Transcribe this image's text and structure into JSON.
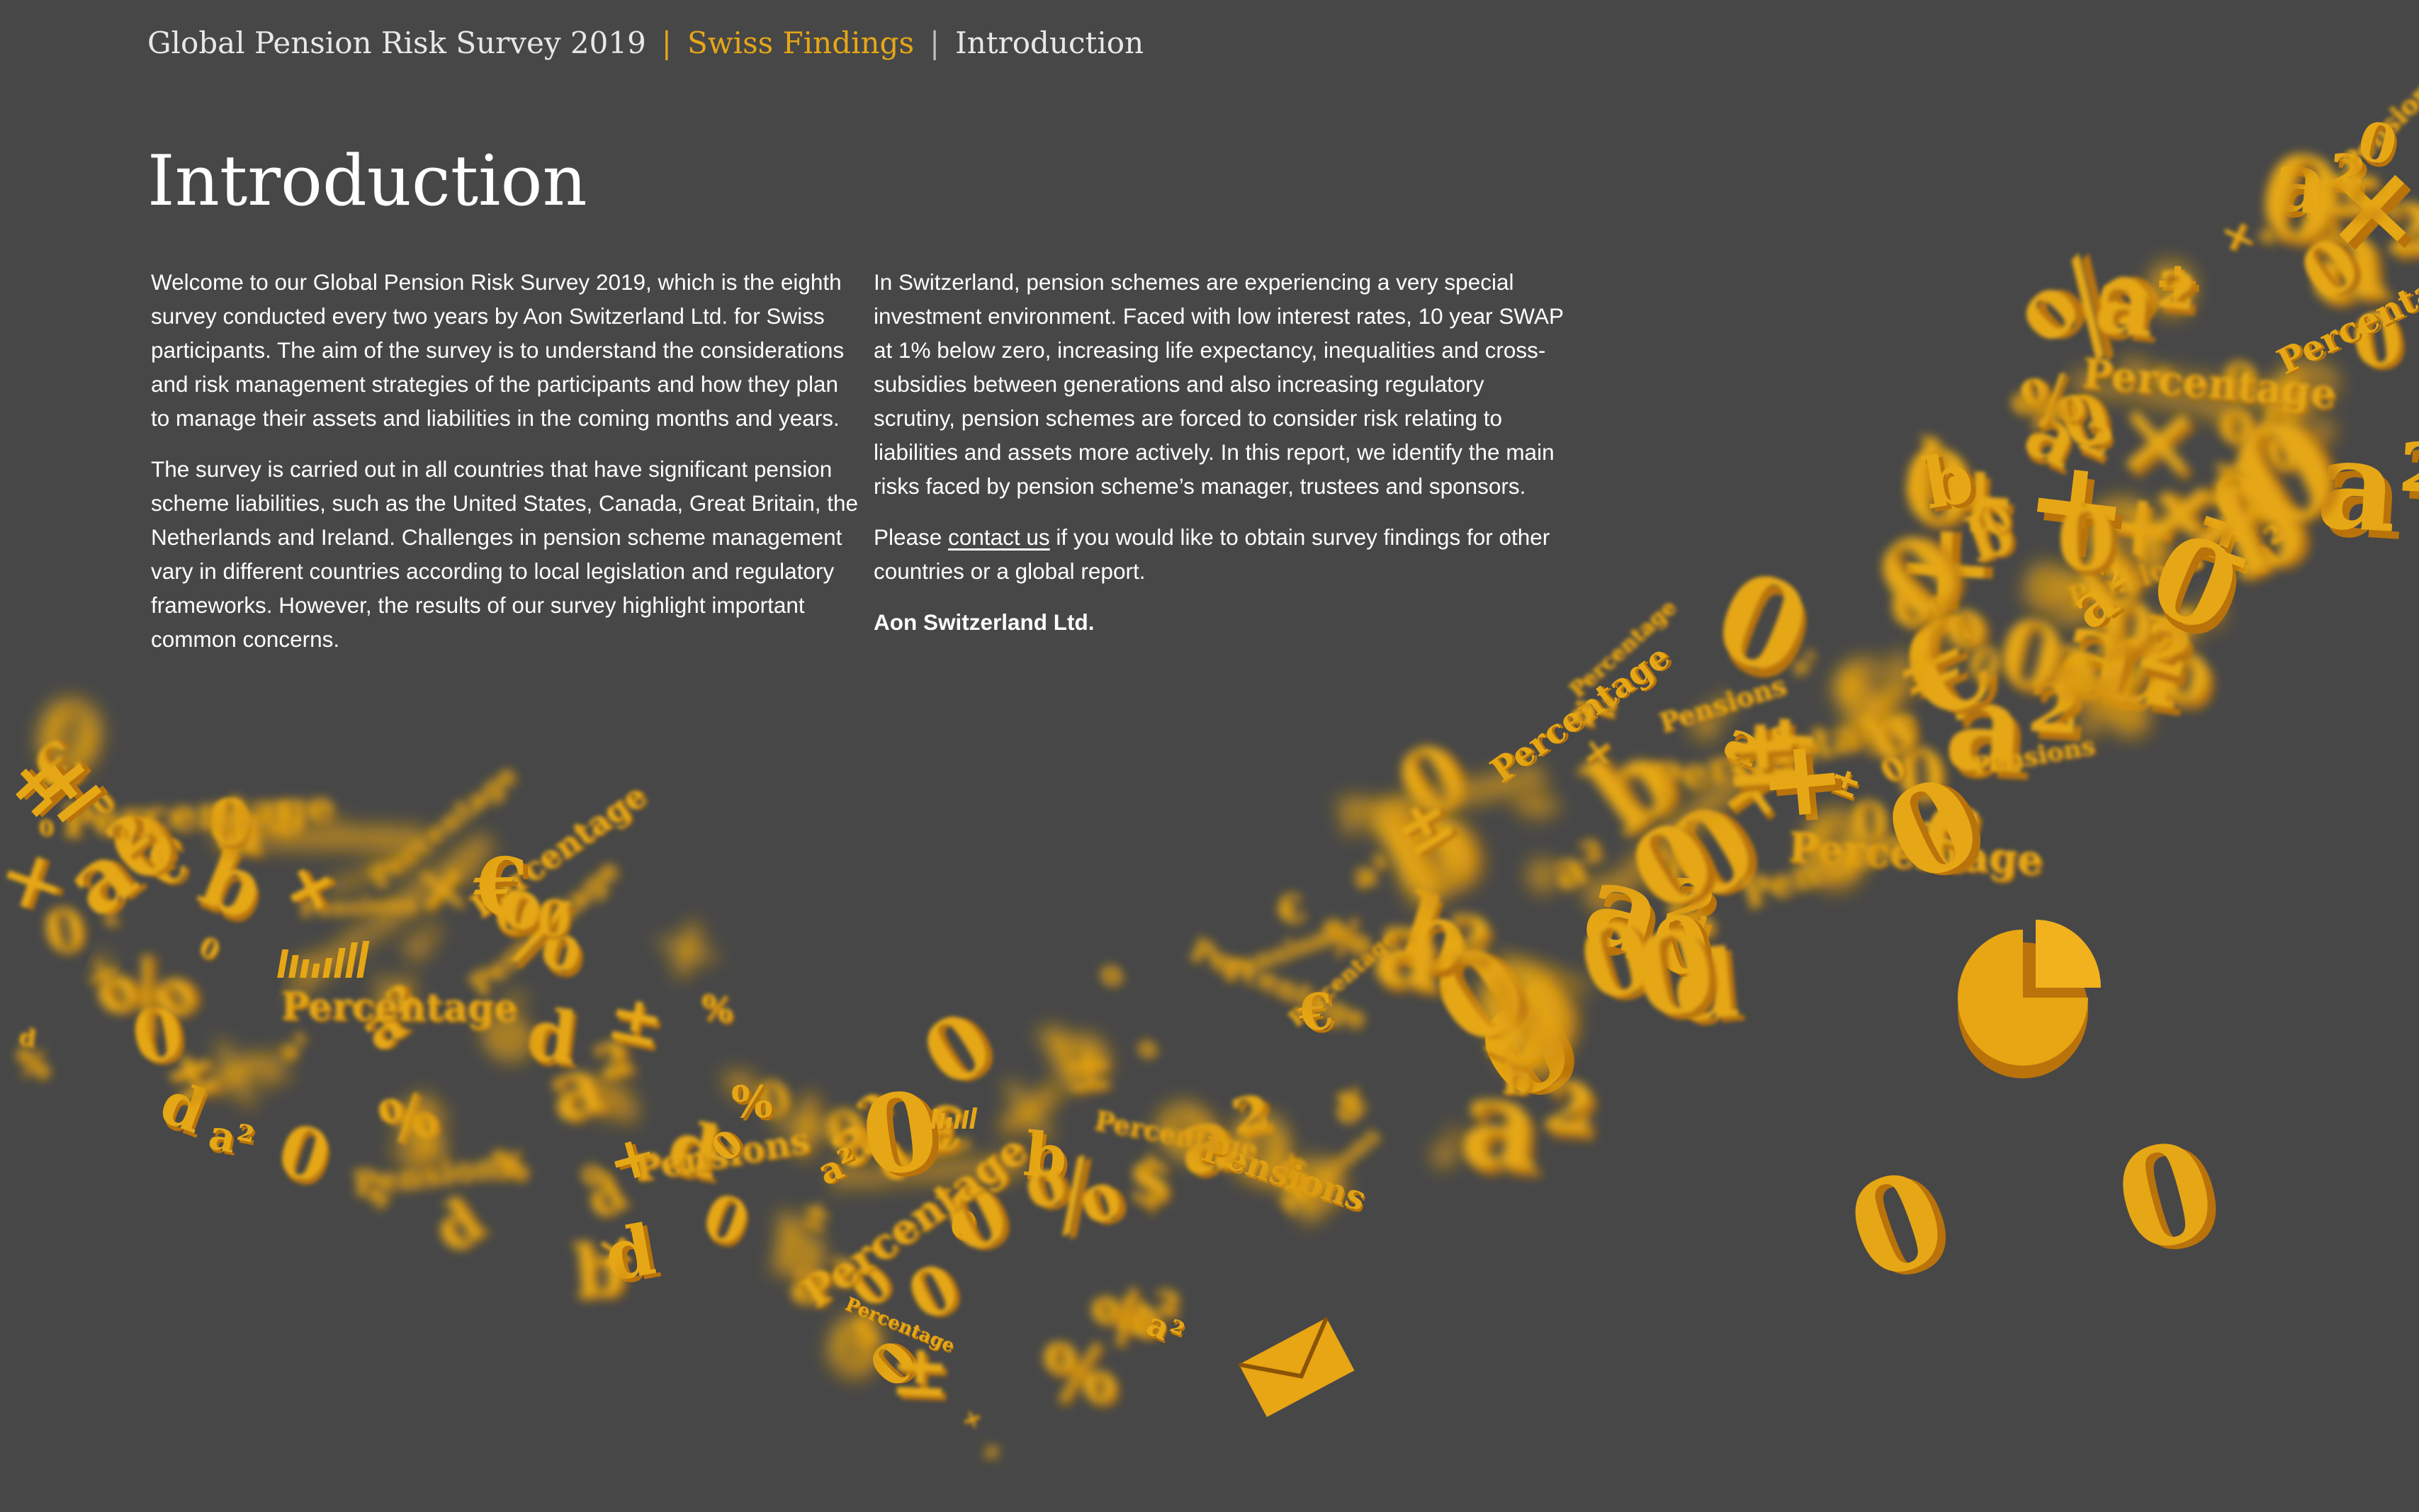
{
  "header": {
    "report_title": "Global Pension Risk Survey 2019",
    "section": "Swiss Findings",
    "current_page": "Introduction",
    "separator": "|"
  },
  "main": {
    "title": "Introduction",
    "left_column": {
      "paragraph_1": "Welcome to our Global Pension Risk Survey 2019, which is the eighth survey conducted every two years by Aon Switzerland Ltd. for Swiss participants. The aim of the survey is to understand the considerations and risk management strategies of the participants and how they plan to manage their assets and liabilities in the coming months and years.",
      "paragraph_2": "The survey is carried out in all countries that have significant pension scheme liabilities, such as the United States, Canada, Great Britain, the Netherlands and Ireland. Challenges in pension scheme management vary in different countries according to local legislation and regulatory frameworks. However, the results of our survey highlight important common concerns."
    },
    "right_column": {
      "paragraph_1": "In Switzerland, pension schemes are experiencing a very special investment environment. Faced with low interest rates, 10 year SWAP at 1% below zero, increasing life expectancy, inequalities and cross-subsidies between generations and also increasing regulatory scrutiny, pension schemes are forced to consider risk relating to liabilities and assets more actively. In this report, we identify the main risks faced by pension scheme’s manager, trustees and sponsors.",
      "contact_prefix": "Please ",
      "contact_link": "contact us",
      "contact_suffix": " if you would like to obtain survey findings for other countries or a global report.",
      "signature": "Aon Switzerland Ltd."
    }
  },
  "decoration": {
    "colors": {
      "background": "#474747",
      "accent": "#e6a716",
      "accent_dark": "#b9730a"
    },
    "glyphs": [
      "0",
      "a²",
      "×",
      "%",
      "+",
      "Pensions",
      "Percentage",
      "$",
      "€",
      "±",
      "pie-chart-icon",
      "bar-chart-icon",
      "envelope-icon"
    ]
  }
}
